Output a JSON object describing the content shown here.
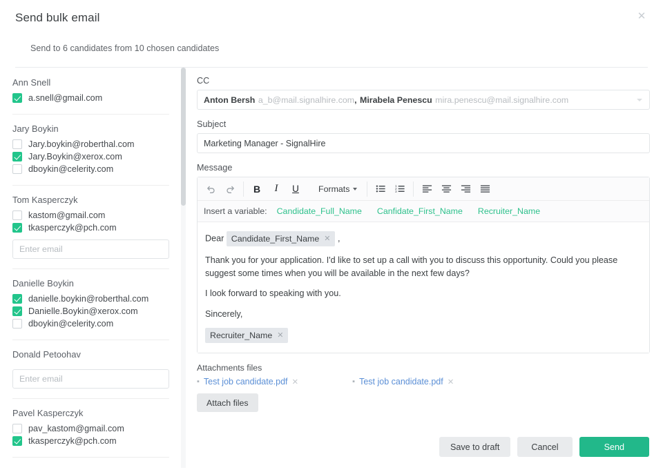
{
  "header": {
    "title": "Send bulk email",
    "subtitle": "Send to 6 candidates from 10 chosen candidates",
    "close_icon": "close-icon"
  },
  "sidebar": {
    "enter_email_placeholder": "Enter email",
    "candidates": [
      {
        "name": "Ann Snell",
        "emails": [
          {
            "address": "a.snell@gmail.com",
            "checked": true
          }
        ],
        "has_input": false
      },
      {
        "name": "Jary Boykin",
        "emails": [
          {
            "address": "Jary.boykin@roberthal.com",
            "checked": false
          },
          {
            "address": "Jary.Boykin@xerox.com",
            "checked": true
          },
          {
            "address": "dboykin@celerity.com",
            "checked": false
          }
        ],
        "has_input": false
      },
      {
        "name": "Tom Kasperczyk",
        "emails": [
          {
            "address": "kastom@gmail.com",
            "checked": false
          },
          {
            "address": "tkasperczyk@pch.com",
            "checked": true
          }
        ],
        "has_input": true
      },
      {
        "name": "Danielle Boykin",
        "emails": [
          {
            "address": "danielle.boykin@roberthal.com",
            "checked": true
          },
          {
            "address": "Danielle.Boykin@xerox.com",
            "checked": true
          },
          {
            "address": "dboykin@celerity.com",
            "checked": false
          }
        ],
        "has_input": false
      },
      {
        "name": "Donald Petoohav",
        "emails": [],
        "has_input": true
      },
      {
        "name": "Pavel Kasperczyk",
        "emails": [
          {
            "address": "pav_kastom@gmail.com",
            "checked": false
          },
          {
            "address": "tkasperczyk@pch.com",
            "checked": true
          }
        ],
        "has_input": false
      }
    ]
  },
  "main": {
    "cc": {
      "label": "CC",
      "recipients": [
        {
          "name": "Anton Bersh",
          "email": "a_b@mail.signalhire.com"
        },
        {
          "name": "Mirabela Penescu",
          "email": "mira.penescu@mail.signalhire.com"
        }
      ],
      "separator": ",",
      "caret_icon": "chevron-down-icon"
    },
    "subject": {
      "label": "Subject",
      "value": "Marketing Manager - SignalHire"
    },
    "message": {
      "label": "Message",
      "toolbar": {
        "undo": "undo-icon",
        "redo": "redo-icon",
        "bold": "B",
        "italic": "I",
        "underline": "U",
        "formats_label": "Formats",
        "bullet_list": "bullet-list-icon",
        "numbered_list": "numbered-list-icon",
        "align_left": "align-left-icon",
        "align_center": "align-center-icon",
        "align_right": "align-right-icon",
        "align_justify": "align-justify-icon"
      },
      "variables": {
        "label": "Insert a variable:",
        "items": [
          "Candidate_Full_Name",
          "Canfidate_First_Name",
          "Recruiter_Name"
        ]
      },
      "body": {
        "greeting_prefix": "Dear",
        "greeting_chip": "Candidate_First_Name",
        "greeting_suffix": ",",
        "paragraph_1": "Thank you for your application. I'd like to set up a call with you to discuss this opportunity. Could you please suggest some times when you will be available in the next few days?",
        "paragraph_2": "I look forward to speaking with you.",
        "paragraph_3": "Sincerely,",
        "signature_chip": "Recruiter_Name",
        "chip_remove_icon": "close-icon"
      }
    },
    "attachments": {
      "label": "Attachments files",
      "files": [
        "Test job candidate.pdf",
        "Test job candidate.pdf"
      ],
      "attach_button": "Attach files",
      "remove_icon": "close-icon"
    },
    "footer": {
      "save_draft": "Save to draft",
      "cancel": "Cancel",
      "send": "Send"
    }
  },
  "colors": {
    "accent_green": "#22b88a",
    "checkbox_green": "#22c58b",
    "variable_link": "#2ec18c",
    "attachment_link": "#5b8fd6"
  }
}
